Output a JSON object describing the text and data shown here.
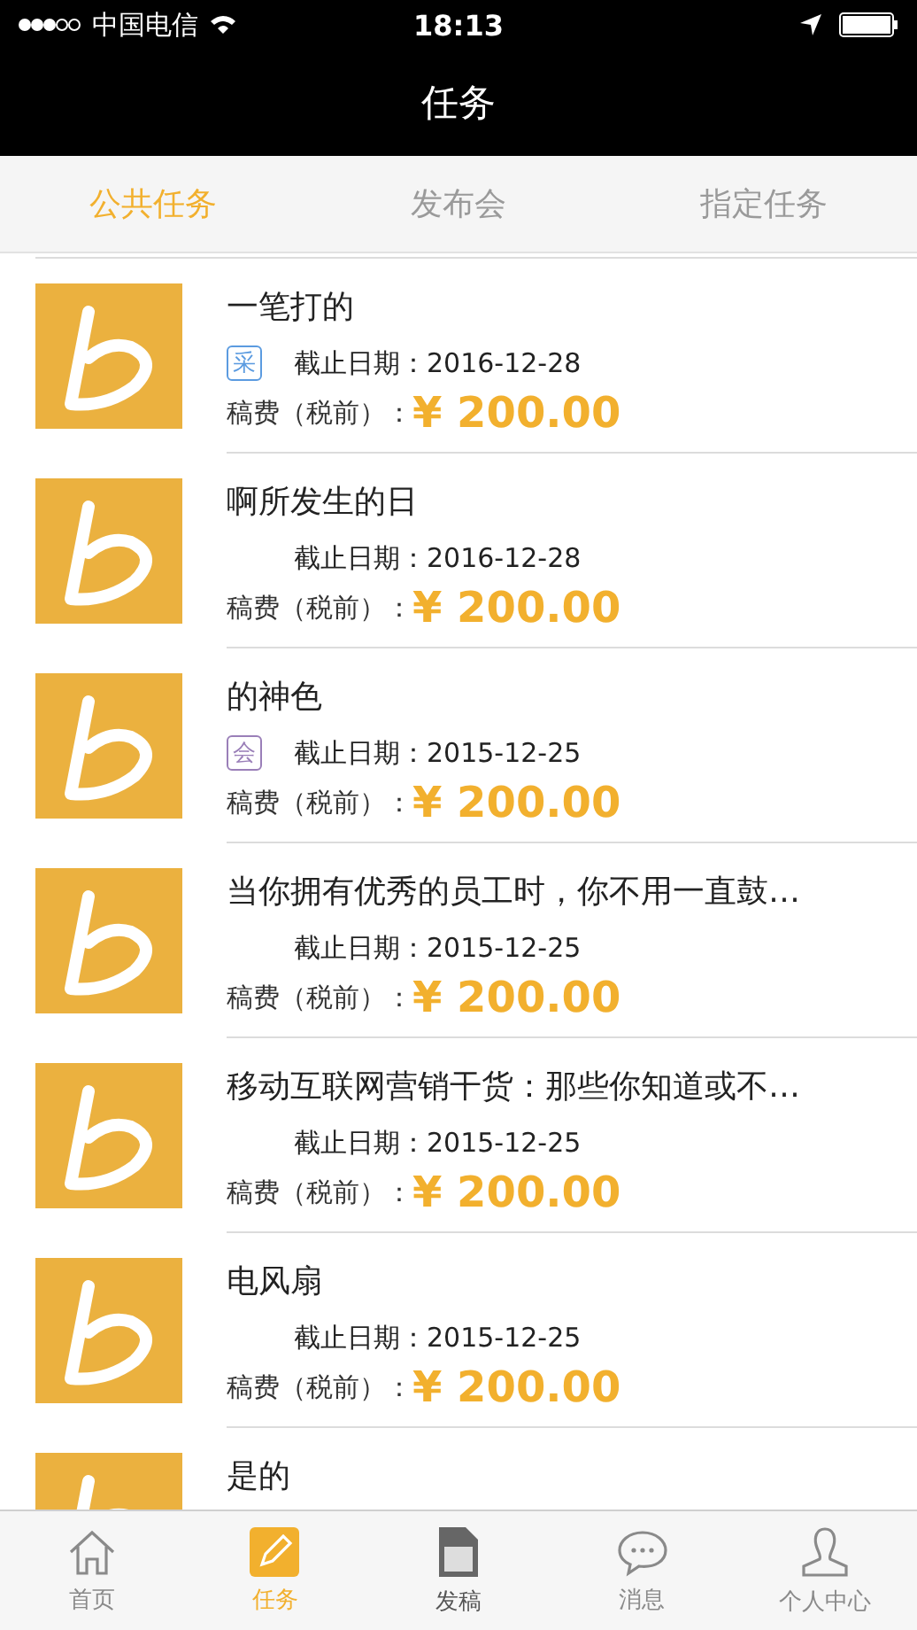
{
  "status_bar": {
    "carrier": "中国电信",
    "time": "18:13"
  },
  "nav": {
    "title": "任务"
  },
  "tabs": [
    {
      "label": "公共任务",
      "selected": true
    },
    {
      "label": "发布会",
      "selected": false
    },
    {
      "label": "指定任务",
      "selected": false
    }
  ],
  "tasks": [
    {
      "title": "一笔打的",
      "tag": {
        "text": "采",
        "color": "#5b9be0"
      },
      "deadline": "截止日期：2016-12-28",
      "fee_label": "稿费（税前）：",
      "fee": "¥ 200.00"
    },
    {
      "title": "啊所发生的日",
      "deadline": "截止日期：2016-12-28",
      "fee_label": "稿费（税前）：",
      "fee": "¥ 200.00"
    },
    {
      "title": "的神色",
      "tag": {
        "text": "会",
        "color": "#9a7fb8"
      },
      "deadline": "截止日期：2015-12-25",
      "fee_label": "稿费（税前）：",
      "fee": "¥ 200.00"
    },
    {
      "title": "当你拥有优秀的员工时，你不用一直鼓…",
      "deadline": "截止日期：2015-12-25",
      "fee_label": "稿费（税前）：",
      "fee": "¥ 200.00"
    },
    {
      "title": "移动互联网营销干货：那些你知道或不…",
      "deadline": "截止日期：2015-12-25",
      "fee_label": "稿费（税前）：",
      "fee": "¥ 200.00"
    },
    {
      "title": "电风扇",
      "deadline": "截止日期：2015-12-25",
      "fee_label": "稿费（税前）：",
      "fee": "¥ 200.00"
    },
    {
      "title": "是的"
    }
  ],
  "tab_bar": [
    {
      "kind": "home",
      "label": "首页",
      "selected": false
    },
    {
      "kind": "task",
      "label": "任务",
      "selected": true
    },
    {
      "kind": "post",
      "label": "发稿",
      "selected": false
    },
    {
      "kind": "message",
      "label": "消息",
      "selected": false
    },
    {
      "kind": "profile",
      "label": "个人中心",
      "selected": false
    }
  ]
}
